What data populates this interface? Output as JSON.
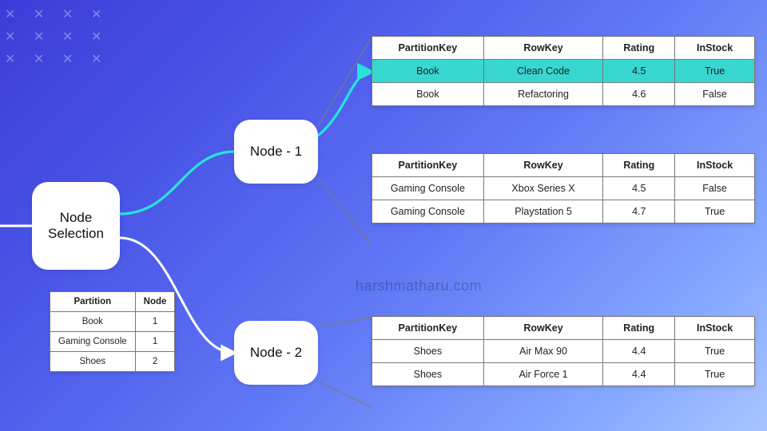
{
  "nodes": {
    "selection": "Node Selection",
    "node1": "Node - 1",
    "node2": "Node - 2"
  },
  "mapping_table": {
    "headers": [
      "Partition",
      "Node"
    ],
    "rows": [
      [
        "Book",
        "1"
      ],
      [
        "Gaming Console",
        "1"
      ],
      [
        "Shoes",
        "2"
      ]
    ]
  },
  "data_tables": [
    {
      "headers": [
        "PartitionKey",
        "RowKey",
        "Rating",
        "InStock"
      ],
      "rows": [
        [
          "Book",
          "Clean Code",
          "4.5",
          "True"
        ],
        [
          "Book",
          "Refactoring",
          "4.6",
          "False"
        ]
      ],
      "highlight_row": 0
    },
    {
      "headers": [
        "PartitionKey",
        "RowKey",
        "Rating",
        "InStock"
      ],
      "rows": [
        [
          "Gaming Console",
          "Xbox Series X",
          "4.5",
          "False"
        ],
        [
          "Gaming Console",
          "Playstation 5",
          "4.7",
          "True"
        ]
      ]
    },
    {
      "headers": [
        "PartitionKey",
        "RowKey",
        "Rating",
        "InStock"
      ],
      "rows": [
        [
          "Shoes",
          "Air Max 90",
          "4.4",
          "True"
        ],
        [
          "Shoes",
          "Air Force 1",
          "4.4",
          "True"
        ]
      ]
    }
  ],
  "watermark": "harshmatharu.com",
  "colors": {
    "highlight": "#37d7d0",
    "arrow_cyan": "#28e3da",
    "arrow_white": "#ffffff"
  }
}
